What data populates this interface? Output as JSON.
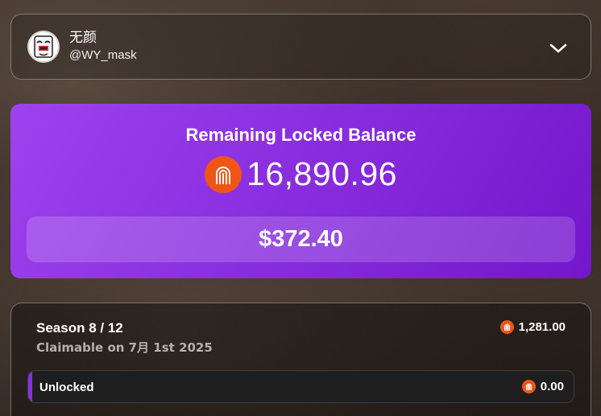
{
  "account": {
    "display_name": "无颜",
    "handle": "@WY_mask",
    "avatar_icon": "mask-avatar-icon",
    "expand_icon": "chevron-down-icon"
  },
  "balance": {
    "title": "Remaining Locked Balance",
    "amount": "16,890.96",
    "usd_value": "$372.40",
    "token_icon": "fingerprint-token-icon",
    "token_color": "#f05518",
    "card_gradient": [
      "#9e42ee",
      "#7416cc"
    ]
  },
  "season": {
    "title": "Season 8 / 12",
    "claimable": "Claimable on 7月 1st 2025",
    "reward": "1,281.00",
    "unlocked_label": "Unlocked",
    "unlocked_amount": "0.00",
    "accent_color": "#8a2fe0"
  }
}
